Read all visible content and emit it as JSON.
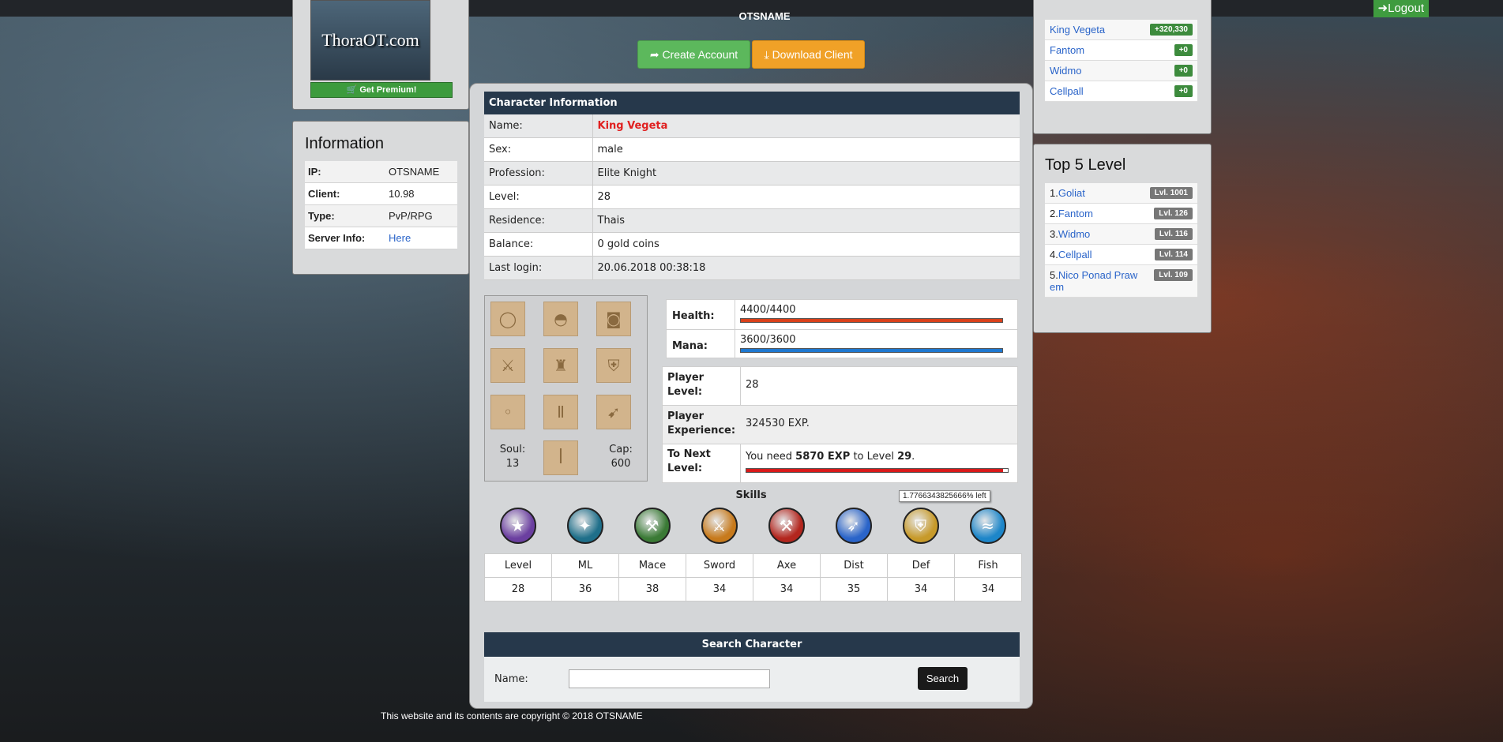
{
  "topbar": {
    "logout_label": "Logout"
  },
  "header": {
    "server_name": "OTSNAME",
    "logo_text": "ThoraOT.com",
    "get_premium_label": "Get Premium!",
    "create_account_label": "Create Account",
    "download_client_label": "Download Client"
  },
  "info_panel": {
    "title": "Information",
    "rows": [
      {
        "key": "IP:",
        "value": "OTSNAME"
      },
      {
        "key": "Client:",
        "value": "10.98"
      },
      {
        "key": "Type:",
        "value": "PvP/RPG"
      },
      {
        "key": "Server Info:",
        "value": "Here"
      }
    ]
  },
  "top_powergamers": {
    "rows": [
      {
        "name": "King Vegeta",
        "value": "+320,330"
      },
      {
        "name": "Fantom",
        "value": "+0"
      },
      {
        "name": "Widmo",
        "value": "+0"
      },
      {
        "name": "Cellpall",
        "value": "+0"
      }
    ]
  },
  "top_level": {
    "title": "Top 5 Level",
    "rows": [
      {
        "rank": "1.",
        "name": "Goliat",
        "level": "Lvl. 1001"
      },
      {
        "rank": "2.",
        "name": "Fantom",
        "level": "Lvl. 126"
      },
      {
        "rank": "3.",
        "name": "Widmo",
        "level": "Lvl. 116"
      },
      {
        "rank": "4.",
        "name": "Cellpall",
        "level": "Lvl. 114"
      },
      {
        "rank": "5.",
        "name": "Nico Ponad Praw em",
        "level": "Lvl. 109"
      }
    ]
  },
  "character": {
    "section_title": "Character Information",
    "rows": [
      {
        "key": "Name:",
        "value": "King Vegeta"
      },
      {
        "key": "Sex:",
        "value": "male"
      },
      {
        "key": "Profession:",
        "value": "Elite Knight"
      },
      {
        "key": "Level:",
        "value": "28"
      },
      {
        "key": "Residence:",
        "value": "Thais"
      },
      {
        "key": "Balance:",
        "value": "0 gold coins"
      },
      {
        "key": "Last login:",
        "value": "20.06.2018 00:38:18"
      }
    ],
    "name_color": "#e02020"
  },
  "equipment": {
    "soul_label": "Soul:",
    "soul_value": "13",
    "cap_label": "Cap:",
    "cap_value": "600"
  },
  "stats": {
    "health_label": "Health:",
    "health_value": "4400/4400",
    "health_fraction": 1.0,
    "health_color": "#d9401a",
    "mana_label": "Mana:",
    "mana_value": "3600/3600",
    "mana_fraction": 1.0,
    "mana_color": "#1e78d0",
    "player_level_label": "Player Level:",
    "player_level_value": "28",
    "player_exp_label": "Player Experience:",
    "player_exp_value": "324530 EXP.",
    "next_level_label": "To Next Level:",
    "next_prefix": "You need ",
    "next_exp": "5870 EXP",
    "next_mid": " to Level ",
    "next_level": "29",
    "next_suffix": ".",
    "next_fraction_left": 0.017766343825666,
    "tooltip": "1.7766343825666% left"
  },
  "skills": {
    "title": "Skills",
    "items": [
      {
        "label": "Level",
        "value": "28",
        "icon": "level-icon",
        "color": "#6b3fa0"
      },
      {
        "label": "ML",
        "value": "36",
        "icon": "magic-level-icon",
        "color": "#1f6f8a"
      },
      {
        "label": "Mace",
        "value": "38",
        "icon": "mace-icon",
        "color": "#3a7a35"
      },
      {
        "label": "Sword",
        "value": "34",
        "icon": "sword-icon",
        "color": "#c77a1c"
      },
      {
        "label": "Axe",
        "value": "34",
        "icon": "axe-icon",
        "color": "#b3261e"
      },
      {
        "label": "Dist",
        "value": "35",
        "icon": "distance-icon",
        "color": "#2a64c9"
      },
      {
        "label": "Def",
        "value": "34",
        "icon": "shield-icon",
        "color": "#c79a2a"
      },
      {
        "label": "Fish",
        "value": "34",
        "icon": "fishing-icon",
        "color": "#1d86c9"
      }
    ]
  },
  "search": {
    "title": "Search Character",
    "name_label": "Name:",
    "input_value": "",
    "button_label": "Search"
  },
  "footer": {
    "copyright": "This website and its contents are copyright © 2018 OTSNAME"
  }
}
